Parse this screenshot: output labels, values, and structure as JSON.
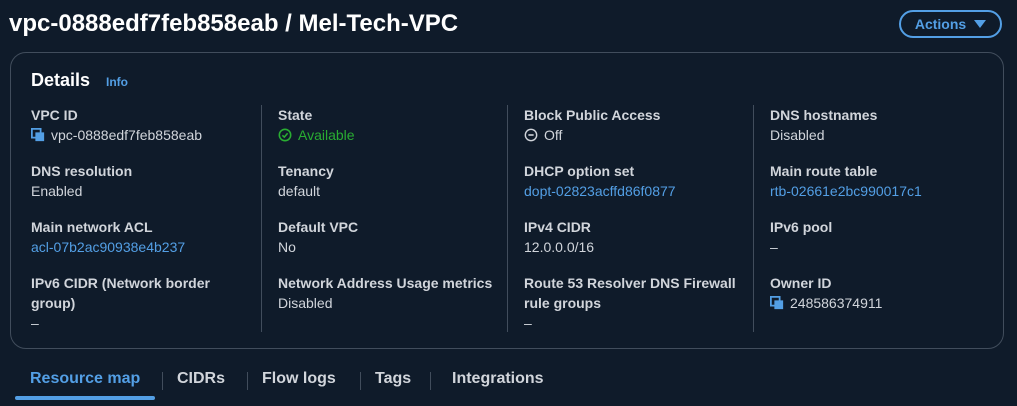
{
  "header": {
    "title": "vpc-0888edf7feb858eab / Mel-Tech-VPC",
    "actions_label": "Actions"
  },
  "details": {
    "title": "Details",
    "info_label": "Info",
    "columns": [
      [
        {
          "label": "VPC ID",
          "value": "vpc-0888edf7feb858eab",
          "kind": "copy"
        },
        {
          "label": "DNS resolution",
          "value": "Enabled",
          "kind": "text"
        },
        {
          "label": "Main network ACL",
          "value": "acl-07b2ac90938e4b237",
          "kind": "link"
        },
        {
          "label_lines": [
            "IPv6 CIDR (Network border",
            "group)"
          ],
          "value": "–",
          "kind": "text"
        }
      ],
      [
        {
          "label": "State",
          "value": "Available",
          "kind": "success"
        },
        {
          "label": "Tenancy",
          "value": "default",
          "kind": "text"
        },
        {
          "label": "Default VPC",
          "value": "No",
          "kind": "text"
        },
        {
          "label": "Network Address Usage metrics",
          "value": "Disabled",
          "kind": "text"
        }
      ],
      [
        {
          "label": "Block Public Access",
          "value": "Off",
          "kind": "off"
        },
        {
          "label": "DHCP option set",
          "value": "dopt-02823acffd86f0877",
          "kind": "link"
        },
        {
          "label": "IPv4 CIDR",
          "value": "12.0.0.0/16",
          "kind": "text"
        },
        {
          "label_lines": [
            "Route 53 Resolver DNS Firewall",
            "rule groups"
          ],
          "value": "–",
          "kind": "text"
        }
      ],
      [
        {
          "label": "DNS hostnames",
          "value": "Disabled",
          "kind": "text"
        },
        {
          "label": "Main route table",
          "value": "rtb-02661e2bc990017c1",
          "kind": "link"
        },
        {
          "label": "IPv6 pool",
          "value": "–",
          "kind": "text"
        },
        {
          "label": "Owner ID",
          "value": "248586374911",
          "kind": "copy"
        }
      ]
    ]
  },
  "tabs": [
    {
      "label": "Resource map",
      "active": true
    },
    {
      "label": "CIDRs",
      "active": false
    },
    {
      "label": "Flow logs",
      "active": false
    },
    {
      "label": "Tags",
      "active": false
    },
    {
      "label": "Integrations",
      "active": false
    }
  ],
  "colors": {
    "background": "#0f1b2a",
    "border": "#414d5c",
    "accent": "#539fe5",
    "success": "#29ad32",
    "text": "#d1d5db"
  },
  "icons": {
    "copy": "copy-icon",
    "success": "check-circle-icon",
    "off": "minus-circle-icon",
    "caret": "caret-down-icon"
  }
}
